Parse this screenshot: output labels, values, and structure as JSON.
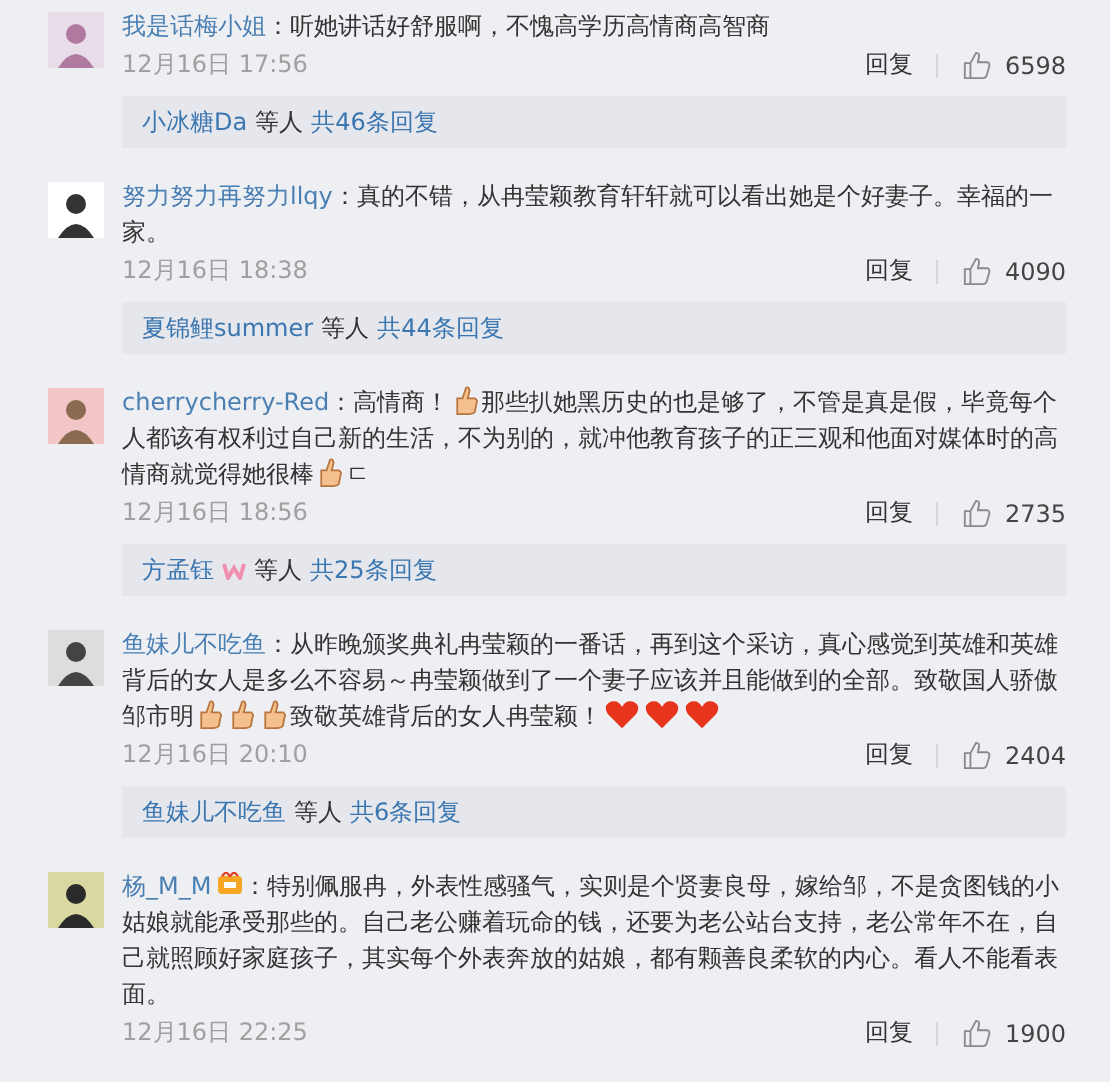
{
  "comments": [
    {
      "user": "我是话梅小姐",
      "has_badge": false,
      "body": [
        {
          "kind": "text",
          "text": "：听她讲话好舒服啊，不愧高学历高情商高智商"
        }
      ],
      "time": "12月16日 17:56",
      "reply_label": "回复",
      "likes": "6598",
      "replies": {
        "users": "小冰糖Da",
        "has_badge": false,
        "middle": "等人",
        "total": "共46条回复"
      }
    },
    {
      "user": "努力努力再努力llqy",
      "has_badge": false,
      "body": [
        {
          "kind": "text",
          "text": "：真的不错，从冉莹颖教育轩轩就可以看出她是个好妻子。幸福的一家。"
        }
      ],
      "time": "12月16日 18:38",
      "reply_label": "回复",
      "likes": "4090",
      "replies": {
        "users": "夏锦鲤summer",
        "has_badge": false,
        "middle": "等人",
        "total": "共44条回复"
      }
    },
    {
      "user": "cherrycherry-Red",
      "has_badge": false,
      "body": [
        {
          "kind": "text",
          "text": "：高情商！"
        },
        {
          "kind": "thumb"
        },
        {
          "kind": "text",
          "text": "那些扒她黑历史的也是够了，不管是真是假，毕竟每个人都该有权利过自己新的生活，不为别的，就冲他教育孩子的正三观和他面对媒体时的高情商就觉得她很棒"
        },
        {
          "kind": "thumb"
        },
        {
          "kind": "text",
          "text": "ㄷ"
        }
      ],
      "time": "12月16日 18:56",
      "reply_label": "回复",
      "likes": "2735",
      "replies": {
        "users": "方孟钰",
        "has_badge": true,
        "middle": "等人",
        "total": "共25条回复"
      }
    },
    {
      "user": "鱼妹儿不吃鱼",
      "has_badge": false,
      "body": [
        {
          "kind": "text",
          "text": "：从昨晚颁奖典礼冉莹颖的一番话，再到这个采访，真心感觉到英雄和英雄背后的女人是多么不容易～冉莹颖做到了一个妻子应该并且能做到的全部。致敬国人骄傲邹市明"
        },
        {
          "kind": "thumb"
        },
        {
          "kind": "thumb"
        },
        {
          "kind": "thumb"
        },
        {
          "kind": "text",
          "text": "致敬英雄背后的女人冉莹颖！"
        },
        {
          "kind": "heart"
        },
        {
          "kind": "heart"
        },
        {
          "kind": "heart"
        }
      ],
      "time": "12月16日 20:10",
      "reply_label": "回复",
      "likes": "2404",
      "replies": {
        "users": "鱼妹儿不吃鱼",
        "has_badge": false,
        "middle": "等人",
        "total": "共6条回复"
      }
    },
    {
      "user": "杨_M_M",
      "has_badge": true,
      "body": [
        {
          "kind": "text",
          "text": "：特别佩服冉，外表性感骚气，实则是个贤妻良母，嫁给邹，不是贪图钱的小姑娘就能承受那些的。自己老公赚着玩命的钱，还要为老公站台支持，老公常年不在，自己就照顾好家庭孩子，其实每个外表奔放的姑娘，都有颗善良柔软的内心。看人不能看表面。"
        }
      ],
      "time": "12月16日 22:25",
      "reply_label": "回复",
      "likes": "1900"
    }
  ]
}
